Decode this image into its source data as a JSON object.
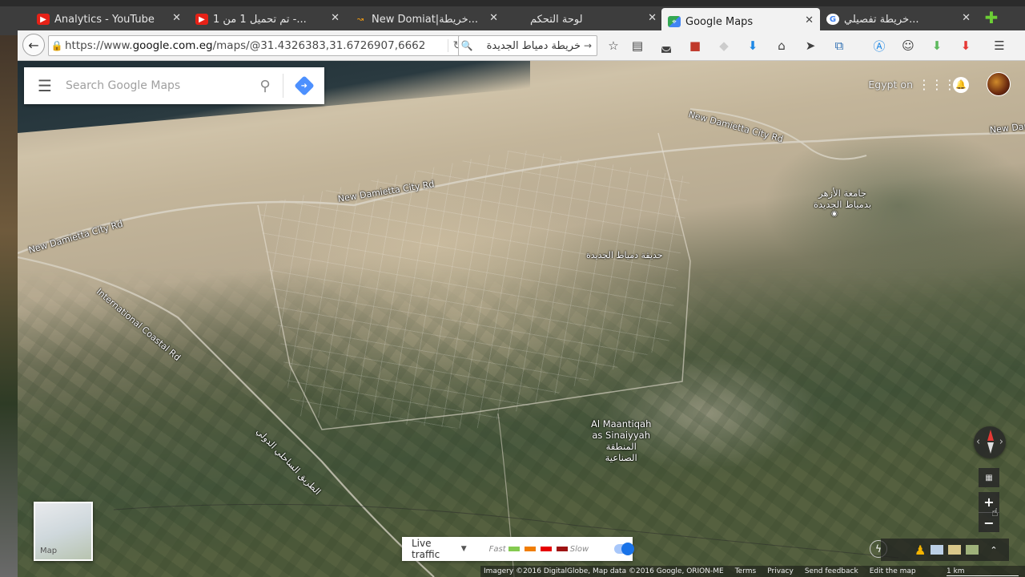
{
  "browser": {
    "tabs": [
      {
        "label": "Analytics - YouTube",
        "icon": "youtube-icon"
      },
      {
        "label": "تم تحميل 1 من 1 -...",
        "icon": "youtube-icon"
      },
      {
        "label": "New Domiat|خريطة...",
        "icon": "amazon-icon"
      },
      {
        "label": "لوحة التحكم",
        "icon": "page-icon"
      },
      {
        "label": "Google Maps",
        "icon": "google-maps-icon"
      },
      {
        "label": "خريطة تفصيلي...",
        "icon": "google-icon"
      }
    ],
    "url_prefix": "https://www.",
    "url_domain": "google.com.eg",
    "url_path": "/maps/@31.4326383,31.6726907,6662",
    "search_value": "خريطة دمياط الجديدة"
  },
  "maps": {
    "search_placeholder": "Search Google Maps",
    "egypt_on": "Egypt on",
    "labels": {
      "road_top": "New Damietta City Rd",
      "road_mid": "New Damietta City Rd",
      "road_left": "New Damietta City Rd",
      "road_right": "New Dam",
      "coastal": "International Coastal Rd",
      "coastal_ar": "الطريق الساحلي الدولي",
      "azhar_ar_1": "جامعة الأزهر",
      "azhar_ar_2": "بدمياط الجديدة",
      "park_ar": "حديقة دمياط الجديدة",
      "industrial_1": "Al Maantiqah",
      "industrial_2": "as Sinaiyyah",
      "industrial_ar_1": "المنطقة",
      "industrial_ar_2": "الصناعية"
    },
    "minimap_label": "Map",
    "traffic": {
      "label": "Live traffic",
      "fast": "Fast",
      "slow": "Slow",
      "colors": [
        "#84ca50",
        "#f07d02",
        "#e60000",
        "#9e1313"
      ],
      "enabled": true
    },
    "footer": {
      "imagery": "Imagery ©2016 DigitalGlobe, Map data ©2016 Google, ORION-ME",
      "terms": "Terms",
      "privacy": "Privacy",
      "feedback": "Send feedback",
      "edit": "Edit the map",
      "scale": "1 km"
    }
  }
}
